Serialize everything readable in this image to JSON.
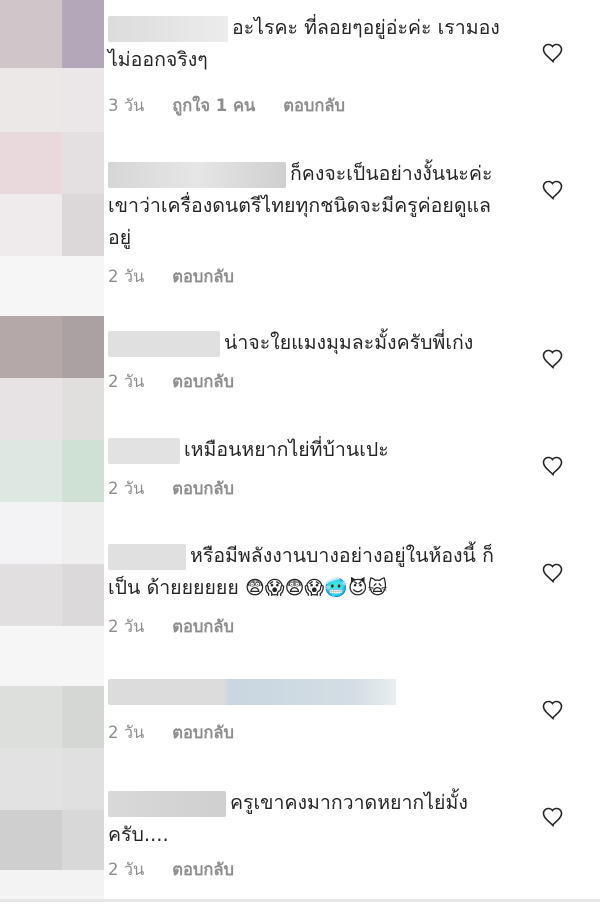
{
  "colors": {
    "text": "#262626",
    "meta": "#8e8e8e",
    "heart_stroke": "#262626",
    "background": "#ffffff"
  },
  "comments": [
    {
      "username_blurred": true,
      "text": "อะไรคะ ที่ลอยๆอยู่อ่ะค่ะ เรามองไม่ออกจริงๆ",
      "meta": {
        "time": "3 วัน",
        "likes": "ถูกใจ 1 คน",
        "reply": "ตอบกลับ"
      }
    },
    {
      "username_blurred": true,
      "text": "ก็คงจะเป็นอย่างงั้นนะค่ะ เขาว่าเครื่องดนตรีไทยทุกชนิดจะมีครูค่อยดูแลอยู่",
      "meta": {
        "time": "2 วัน",
        "reply": "ตอบกลับ"
      }
    },
    {
      "username_blurred": true,
      "text": "น่าจะใยแมงมุมละมั้งครับพี่เก่ง",
      "meta": {
        "time": "2 วัน",
        "reply": "ตอบกลับ"
      }
    },
    {
      "username_blurred": true,
      "text": "เหมือนหยากไย่ที่บ้านเปะ",
      "meta": {
        "time": "2 วัน",
        "reply": "ตอบกลับ"
      }
    },
    {
      "username_blurred": true,
      "text": "หรือมีพลังงานบางอย่างอยู่ในห้องนี้ ก็ เป็น ด้ายยยยยย",
      "emojis": "😨😱😨😱🥶😈🙀",
      "meta": {
        "time": "2 วัน",
        "reply": "ตอบกลับ"
      }
    },
    {
      "username_blurred": true,
      "text": "",
      "meta": {
        "time": "2 วัน",
        "reply": "ตอบกลับ"
      }
    },
    {
      "username_blurred": true,
      "text": "ครูเขาคงมากวาดหยากไย่มั้งครับ....",
      "meta": {
        "time": "2 วัน",
        "reply": "ตอบกลับ"
      }
    }
  ],
  "icons": {
    "like": "heart-outline-icon"
  }
}
